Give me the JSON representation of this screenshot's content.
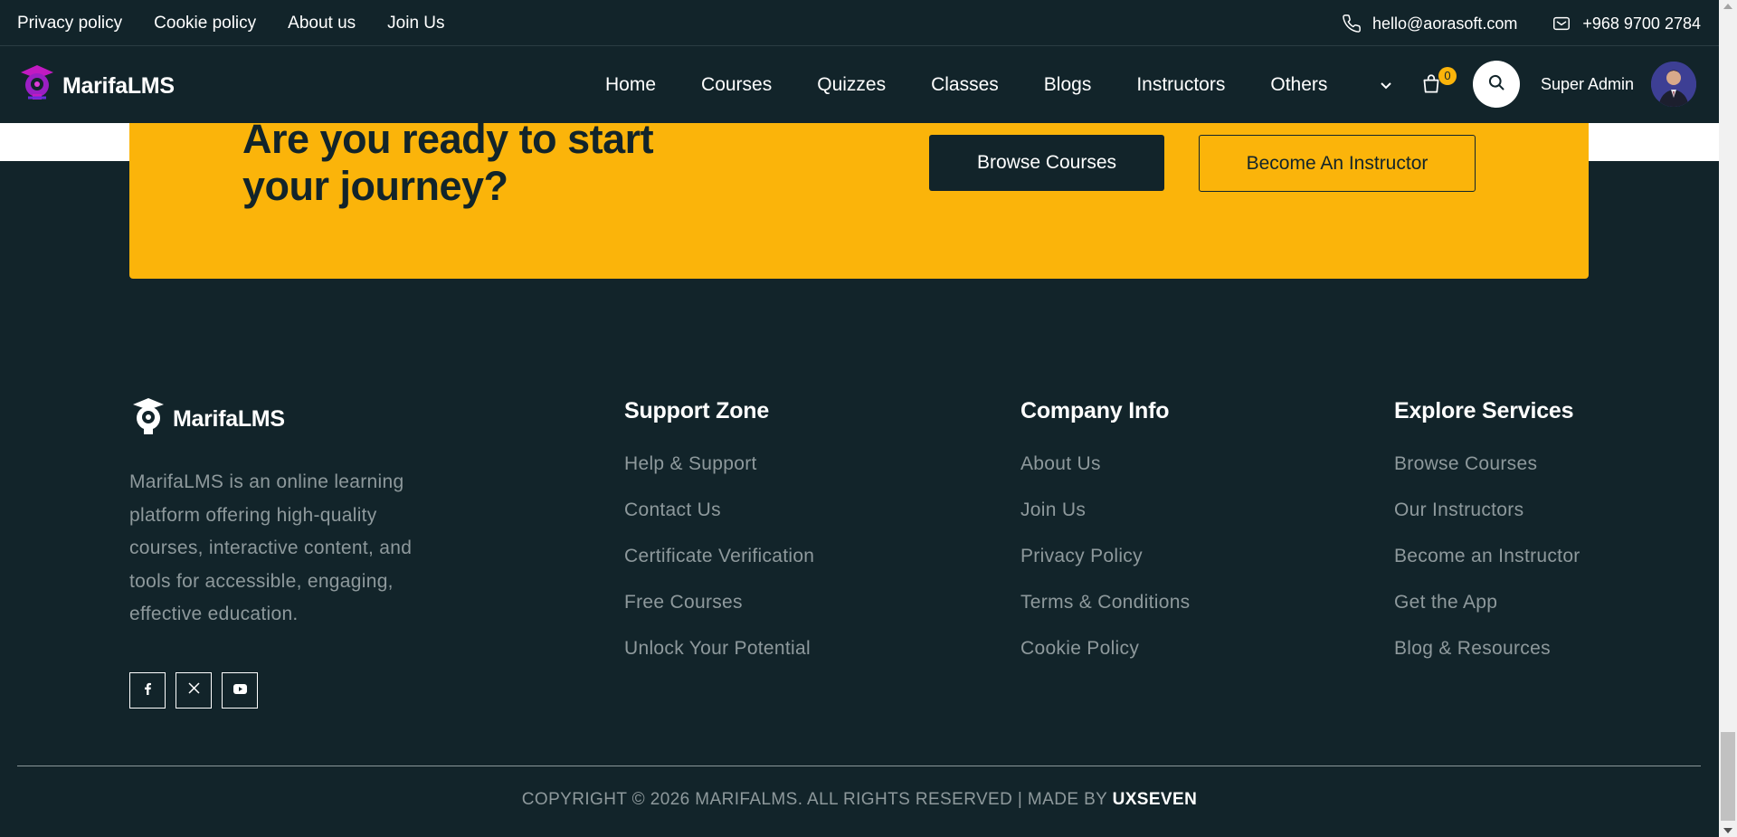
{
  "topbar": {
    "links": [
      "Privacy policy",
      "Cookie policy",
      "About us",
      "Join Us"
    ],
    "email": "hello@aorasoft.com",
    "phone": "+968 9700 2784",
    "email_icon": "phone-icon",
    "phone_icon": "mail-icon"
  },
  "header": {
    "logo_text": "MarifaLMS",
    "nav": [
      "Home",
      "Courses",
      "Quizzes",
      "Classes",
      "Blogs",
      "Instructors"
    ],
    "others_label": "Others",
    "cart_count": "0",
    "user_name": "Super Admin"
  },
  "cta": {
    "title": "Are you ready to start your journey?",
    "browse_label": "Browse Courses",
    "instructor_label": "Become An Instructor"
  },
  "footer": {
    "logo_text": "MarifaLMS",
    "description": "MarifaLMS is an online learning platform offering high-quality courses, interactive content, and tools for accessible, engaging, effective education.",
    "support": {
      "title": "Support Zone",
      "items": [
        "Help & Support",
        "Contact Us",
        "Certificate Verification",
        "Free Courses",
        "Unlock Your Potential"
      ]
    },
    "company": {
      "title": "Company Info",
      "items": [
        "About Us",
        "Join Us",
        "Privacy Policy",
        "Terms & Conditions",
        "Cookie Policy"
      ]
    },
    "explore": {
      "title": "Explore Services",
      "items": [
        "Browse Courses",
        "Our Instructors",
        "Become an Instructor",
        "Get the App",
        "Blog & Resources"
      ]
    },
    "copyright_prefix": "COPYRIGHT © 2026 MARIFALMS. ALL RIGHTS RESERVED | MADE BY",
    "copyright_brand": "UXSEVEN"
  },
  "colors": {
    "background": "#12242a",
    "accent": "#fbb40a",
    "muted_text": "#8e999c"
  }
}
